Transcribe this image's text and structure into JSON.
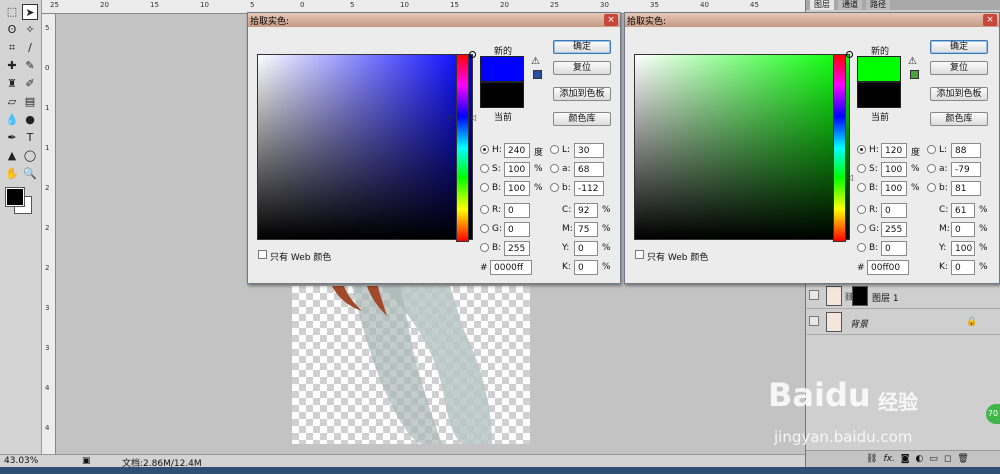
{
  "status": {
    "zoom": "43.03%",
    "doc": "文档:2.86M/12.4M"
  },
  "panel_tabs": [
    "图层",
    "通道",
    "路径"
  ],
  "layers": [
    {
      "name": "图层 1"
    },
    {
      "name": "背景",
      "lock": "🔒"
    }
  ],
  "watermark": {
    "brand": "Baidu",
    "cn": "经验",
    "url": "jingyan.baidu.com",
    "badge": "70"
  },
  "rulers": {
    "top": [
      "25",
      "20",
      "15",
      "10",
      "5",
      "0",
      "5",
      "10",
      "15",
      "20",
      "25",
      "30",
      "35",
      "40",
      "45"
    ],
    "left": [
      "5",
      "0",
      "1",
      "1",
      "2",
      "2",
      "2",
      "3",
      "3",
      "4",
      "4"
    ]
  },
  "dialogs": [
    {
      "title": "拾取实色:",
      "close": "×",
      "new_label": "新的",
      "current_label": "当前",
      "new_color": "#0000ff",
      "current_color": "#000000",
      "gamut_warning_icon": "⚠",
      "web_cube_color": "#2a4fa0",
      "buttons": {
        "ok": "确定",
        "reset": "复位",
        "add": "添加到色板",
        "library": "颜色库"
      },
      "hsb": [
        {
          "label": "H:",
          "value": "240",
          "unit": "度",
          "checked": true
        },
        {
          "label": "S:",
          "value": "100",
          "unit": "%",
          "checked": false
        },
        {
          "label": "B:",
          "value": "100",
          "unit": "%",
          "checked": false
        }
      ],
      "rgb": [
        {
          "label": "R:",
          "value": "0"
        },
        {
          "label": "G:",
          "value": "0"
        },
        {
          "label": "B:",
          "value": "255"
        }
      ],
      "lab": [
        {
          "label": "L:",
          "value": "30"
        },
        {
          "label": "a:",
          "value": "68"
        },
        {
          "label": "b:",
          "value": "-112"
        }
      ],
      "cmyk": [
        {
          "label": "C:",
          "value": "92",
          "unit": "%"
        },
        {
          "label": "M:",
          "value": "75",
          "unit": "%"
        },
        {
          "label": "Y:",
          "value": "0",
          "unit": "%"
        },
        {
          "label": "K:",
          "value": "0",
          "unit": "%"
        }
      ],
      "hex_label": "#",
      "hex": "0000ff",
      "web_only_label": "只有 Web 颜色",
      "field_hue": "#0000ff"
    },
    {
      "title": "拾取实色:",
      "close": "×",
      "new_label": "新的",
      "current_label": "当前",
      "new_color": "#00ff00",
      "current_color": "#000000",
      "gamut_warning_icon": "⚠",
      "web_cube_color": "#4aa33a",
      "buttons": {
        "ok": "确定",
        "reset": "复位",
        "add": "添加到色板",
        "library": "颜色库"
      },
      "hsb": [
        {
          "label": "H:",
          "value": "120",
          "unit": "度",
          "checked": true
        },
        {
          "label": "S:",
          "value": "100",
          "unit": "%",
          "checked": false
        },
        {
          "label": "B:",
          "value": "100",
          "unit": "%",
          "checked": false
        }
      ],
      "rgb": [
        {
          "label": "R:",
          "value": "0"
        },
        {
          "label": "G:",
          "value": "255"
        },
        {
          "label": "B:",
          "value": "0"
        }
      ],
      "lab": [
        {
          "label": "L:",
          "value": "88"
        },
        {
          "label": "a:",
          "value": "-79"
        },
        {
          "label": "b:",
          "value": "81"
        }
      ],
      "cmyk": [
        {
          "label": "C:",
          "value": "61",
          "unit": "%"
        },
        {
          "label": "M:",
          "value": "0",
          "unit": "%"
        },
        {
          "label": "Y:",
          "value": "100",
          "unit": "%"
        },
        {
          "label": "K:",
          "value": "0",
          "unit": "%"
        }
      ],
      "hex_label": "#",
      "hex": "00ff00",
      "web_only_label": "只有 Web 颜色",
      "field_hue": "#00ff00"
    }
  ]
}
